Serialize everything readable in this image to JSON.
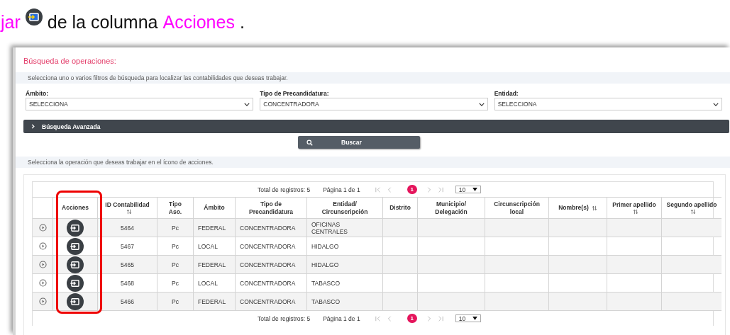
{
  "caption": [
    {
      "kind": "highlight",
      "text": "jar"
    },
    {
      "kind": "icon"
    },
    {
      "kind": "plain",
      "text": "de la columna"
    },
    {
      "kind": "highlight",
      "text": "Acciones"
    },
    {
      "kind": "plain",
      "text": "."
    }
  ],
  "panel": {
    "title": "Búsqueda de operaciones:",
    "instructions": "Selecciona uno o varios filtros de búsqueda para localizar las contabilidades que deseas trabajar.",
    "filters": [
      {
        "label": "Ámbito:",
        "value": "SELECCIONA"
      },
      {
        "label": "Tipo de Precandidatura:",
        "value": "CONCENTRADORA"
      },
      {
        "label": "Entidad:",
        "value": "SELECCIONA"
      }
    ],
    "advanced": {
      "label": "Búsqueda Avanzada",
      "expanded": false
    },
    "search_button": "Buscar",
    "table_hint": "Selecciona la operación que deseas trabajar en el ícono de acciones."
  },
  "table": {
    "pager_top": {
      "total": "Total de registros: 5",
      "page": "Página 1 de 1",
      "pages": [
        {
          "label": "1",
          "selected": true
        }
      ],
      "page_size": "10"
    },
    "columns": [
      {
        "label": "Acciones",
        "sortable": false,
        "highlighted": true
      },
      {
        "label": "ID Contabilidad",
        "sortable": true,
        "highlighted": false
      },
      {
        "label": "Tipo Aso.",
        "sortable": false,
        "highlighted": false
      },
      {
        "label": "Ámbito",
        "sortable": false,
        "highlighted": false
      },
      {
        "label": "Tipo de Precandidatura",
        "sortable": false,
        "highlighted": false
      },
      {
        "label": "Entidad/ Circunscripción",
        "sortable": false,
        "highlighted": false
      },
      {
        "label": "Distrito",
        "sortable": false,
        "highlighted": false
      },
      {
        "label": "Municipio/ Delegación",
        "sortable": false,
        "highlighted": false
      },
      {
        "label": "Circunscripción local",
        "sortable": false,
        "highlighted": false
      },
      {
        "label": "Nombre(s)",
        "sortable": true,
        "highlighted": false
      },
      {
        "label": "Primer apellido",
        "sortable": true,
        "highlighted": false
      },
      {
        "label": "Segundo apellido",
        "sortable": true,
        "highlighted": false
      }
    ],
    "rows": [
      {
        "id_contabilidad": "5464",
        "tipo_aso": "Pc",
        "ambito": "FEDERAL",
        "tipo_precandidatura": "CONCENTRADORA",
        "entidad": "OFICINAS CENTRALES"
      },
      {
        "id_contabilidad": "5467",
        "tipo_aso": "Pc",
        "ambito": "LOCAL",
        "tipo_precandidatura": "CONCENTRADORA",
        "entidad": "HIDALGO"
      },
      {
        "id_contabilidad": "5465",
        "tipo_aso": "Pc",
        "ambito": "FEDERAL",
        "tipo_precandidatura": "CONCENTRADORA",
        "entidad": "HIDALGO"
      },
      {
        "id_contabilidad": "5468",
        "tipo_aso": "Pc",
        "ambito": "LOCAL",
        "tipo_precandidatura": "CONCENTRADORA",
        "entidad": "TABASCO"
      },
      {
        "id_contabilidad": "5466",
        "tipo_aso": "Pc",
        "ambito": "FEDERAL",
        "tipo_precandidatura": "CONCENTRADORA",
        "entidad": "TABASCO"
      }
    ],
    "pager_bottom": {
      "total": "Total de registros: 5",
      "page": "Página 1 de 1",
      "pages": [
        {
          "label": "1",
          "selected": true
        }
      ],
      "page_size": "10"
    }
  }
}
